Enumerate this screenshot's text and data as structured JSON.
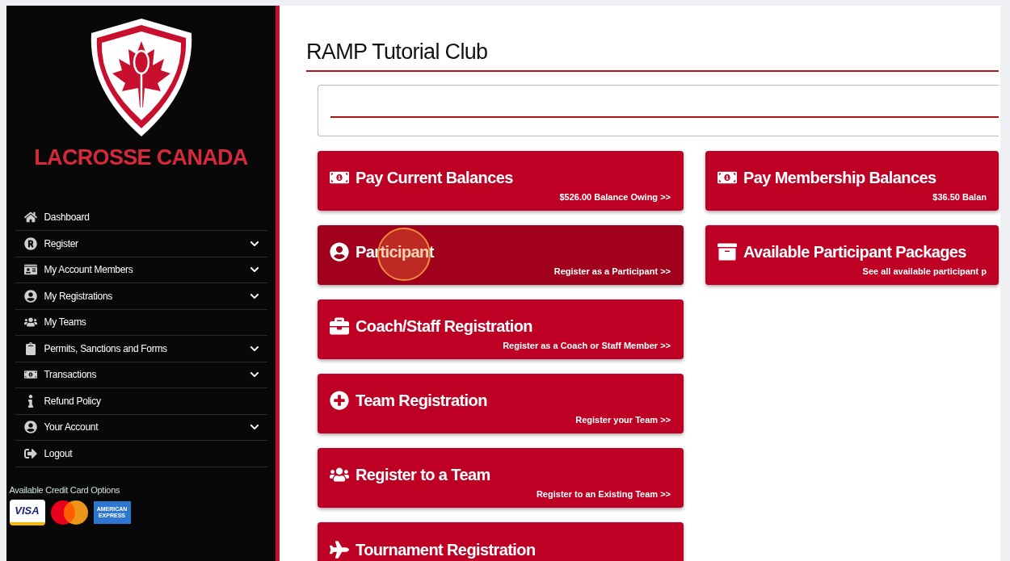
{
  "sidebar": {
    "brand": "LACROSSE CANADA",
    "items": [
      {
        "label": "Dashboard",
        "kind": "link"
      },
      {
        "label": "Register",
        "kind": "submenu"
      },
      {
        "label": "My Account Members",
        "kind": "submenu"
      },
      {
        "label": "My Registrations",
        "kind": "submenu"
      },
      {
        "label": "My Teams",
        "kind": "link"
      },
      {
        "label": "Permits, Sanctions and Forms",
        "kind": "submenu"
      },
      {
        "label": "Transactions",
        "kind": "submenu"
      },
      {
        "label": "Refund Policy",
        "kind": "link"
      },
      {
        "label": "Your Account",
        "kind": "submenu"
      },
      {
        "label": "Logout",
        "kind": "link"
      }
    ],
    "cards_heading": "Available Credit Card Options",
    "cards": [
      {
        "kind": "visa",
        "label": "VISA"
      },
      {
        "kind": "mastercard"
      },
      {
        "kind": "amex",
        "label": "AMERICAN EXPRESS"
      }
    ]
  },
  "main": {
    "title": "RAMP Tutorial Club",
    "left_tiles": [
      {
        "title": "Pay Current Balances",
        "subtitle": "$526.00 Balance Owing >>",
        "highlighted": false
      },
      {
        "title": "Participant",
        "subtitle": "Register as a Participant >>",
        "highlighted": true
      },
      {
        "title": "Coach/Staff Registration",
        "subtitle": "Register as a Coach or Staff Member >>",
        "highlighted": false
      },
      {
        "title": "Team Registration",
        "subtitle": "Register your Team >>",
        "highlighted": false
      },
      {
        "title": "Register to a Team",
        "subtitle": "Register to an Existing Team >>",
        "highlighted": false
      },
      {
        "title": "Tournament Registration",
        "highlighted": false
      }
    ],
    "right_tiles": [
      {
        "title": "Pay Membership Balances",
        "subtitle": "$36.50 Balan",
        "highlighted": false
      },
      {
        "title": "Available Participant Packages",
        "subtitle": "See all available participant p",
        "highlighted": false
      }
    ]
  }
}
